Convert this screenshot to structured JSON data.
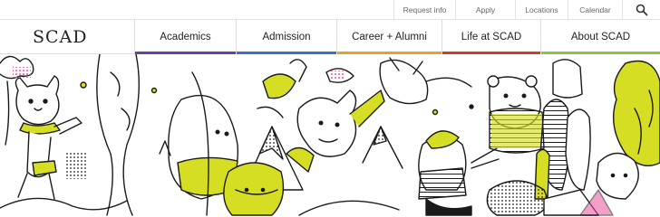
{
  "utility": {
    "links": [
      "Request info",
      "Apply",
      "Locations",
      "Calendar"
    ],
    "search_icon": "search-icon"
  },
  "header": {
    "logo": "SCAD"
  },
  "nav": {
    "items": [
      {
        "label": "Academics",
        "accent": "#6b3fa0"
      },
      {
        "label": "Admission",
        "accent": "#3b6fc4"
      },
      {
        "label": "Career + Alumni",
        "accent": "#e7a22b"
      },
      {
        "label": "Life at SCAD",
        "accent": "#d23a2f"
      },
      {
        "label": "About SCAD",
        "accent": "#8cc63f"
      }
    ]
  },
  "colors": {
    "illustration_accent": "#d6de23",
    "illustration_pink": "#ec4fa0",
    "line": "#1a1a1a"
  }
}
